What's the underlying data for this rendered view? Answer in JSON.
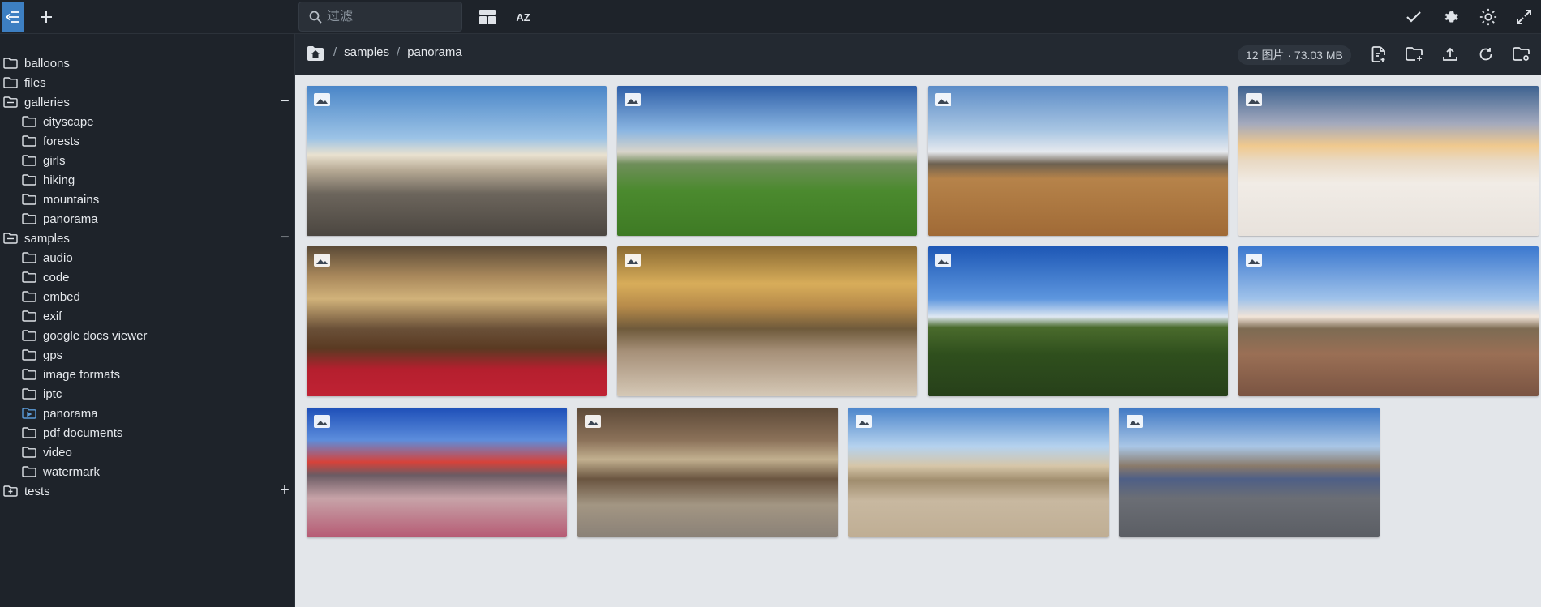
{
  "topbar": {
    "search_placeholder": "过滤",
    "sort_label": "AZ"
  },
  "sidebar": {
    "items": [
      {
        "label": "balloons",
        "level": 0,
        "toggle": ""
      },
      {
        "label": "files",
        "level": 0,
        "toggle": ""
      },
      {
        "label": "galleries",
        "level": 0,
        "toggle": "−"
      },
      {
        "label": "cityscape",
        "level": 1,
        "toggle": ""
      },
      {
        "label": "forests",
        "level": 1,
        "toggle": ""
      },
      {
        "label": "girls",
        "level": 1,
        "toggle": ""
      },
      {
        "label": "hiking",
        "level": 1,
        "toggle": ""
      },
      {
        "label": "mountains",
        "level": 1,
        "toggle": ""
      },
      {
        "label": "panorama",
        "level": 1,
        "toggle": ""
      },
      {
        "label": "samples",
        "level": 0,
        "toggle": "−"
      },
      {
        "label": "audio",
        "level": 1,
        "toggle": ""
      },
      {
        "label": "code",
        "level": 1,
        "toggle": ""
      },
      {
        "label": "embed",
        "level": 1,
        "toggle": ""
      },
      {
        "label": "exif",
        "level": 1,
        "toggle": ""
      },
      {
        "label": "google docs viewer",
        "level": 1,
        "toggle": ""
      },
      {
        "label": "gps",
        "level": 1,
        "toggle": ""
      },
      {
        "label": "image formats",
        "level": 1,
        "toggle": ""
      },
      {
        "label": "iptc",
        "level": 1,
        "toggle": ""
      },
      {
        "label": "panorama",
        "level": 1,
        "toggle": "",
        "active": true
      },
      {
        "label": "pdf documents",
        "level": 1,
        "toggle": ""
      },
      {
        "label": "video",
        "level": 1,
        "toggle": ""
      },
      {
        "label": "watermark",
        "level": 1,
        "toggle": ""
      },
      {
        "label": "tests",
        "level": 0,
        "toggle": "+"
      }
    ]
  },
  "breadcrumb": {
    "segments": [
      "samples",
      "panorama"
    ],
    "separator": "/"
  },
  "info": {
    "summary": "12 图片 · 73.03 MB"
  },
  "colors": {
    "accent": "#3d7fc2",
    "panel": "#1e232a",
    "content_bg": "#e3e6ea"
  },
  "gallery": {
    "items": [
      {
        "scene": "colonial-street"
      },
      {
        "scene": "monastery-cemetery"
      },
      {
        "scene": "wind-turbines-coast"
      },
      {
        "scene": "snowy-mountains-sunset"
      },
      {
        "scene": "cathedral-interior"
      },
      {
        "scene": "living-room"
      },
      {
        "scene": "aerial-forest-lake"
      },
      {
        "scene": "aerial-city"
      },
      {
        "scene": "shopping-street"
      },
      {
        "scene": "cave-temple"
      },
      {
        "scene": "town-square"
      },
      {
        "scene": "graffiti-square"
      }
    ]
  }
}
